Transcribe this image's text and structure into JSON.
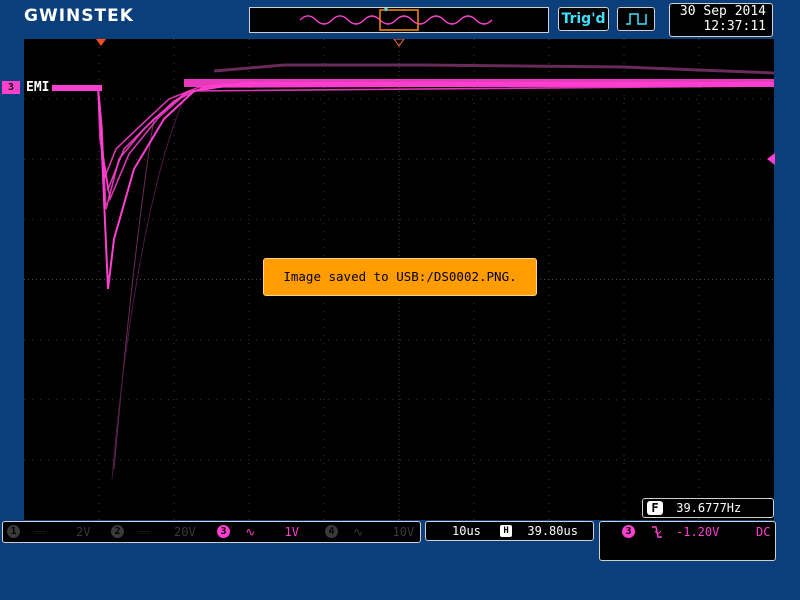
{
  "brand": "GWINSTEK",
  "trigger_status": "Trig'd",
  "date": "30 Sep 2014",
  "time": "12:37:11",
  "channel_label": {
    "number": "3",
    "name": "EMI"
  },
  "message": "Image saved to USB:/DS0002.PNG.",
  "frequency": {
    "badge": "F",
    "value": "39.6777Hz"
  },
  "channels": [
    {
      "number": "1",
      "coupling": "⎓",
      "scale": "2V",
      "active": false
    },
    {
      "number": "2",
      "coupling": "⎓",
      "scale": "20V",
      "active": false
    },
    {
      "number": "3",
      "coupling": "∿",
      "scale": "1V",
      "active": true
    },
    {
      "number": "4",
      "coupling": "∿",
      "scale": "10V",
      "active": false
    }
  ],
  "timebase": {
    "scale": "10us",
    "position_badge": "H",
    "position": "39.80us"
  },
  "trigger": {
    "source": "3",
    "slope": "falling-edge-icon",
    "level": "-1.20V",
    "coupling": "DC"
  },
  "colors": {
    "waveform": "#ff3fd0",
    "background": "#0b3f7c",
    "message": "#ff9c00",
    "trigger_text": "#3fe0ff"
  }
}
